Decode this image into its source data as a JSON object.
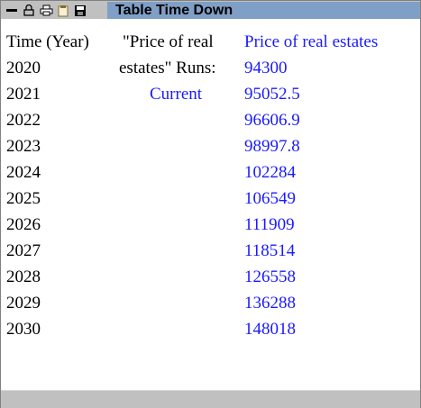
{
  "window": {
    "title": "Table Time Down",
    "toolbar_icons": [
      "minimize-icon",
      "lock-icon",
      "print-icon",
      "copy-icon",
      "save-icon"
    ]
  },
  "table": {
    "time_header": "Time (Year)",
    "runs_label_line1": "\"Price of real",
    "runs_label_line2": "estates\"  Runs:",
    "run_name": "Current",
    "variable_header": "Price of real estates",
    "rows": [
      {
        "time": "2020",
        "value": "94300"
      },
      {
        "time": "2021",
        "value": "95052.5"
      },
      {
        "time": "2022",
        "value": "96606.9"
      },
      {
        "time": "2023",
        "value": "98997.8"
      },
      {
        "time": "2024",
        "value": "102284"
      },
      {
        "time": "2025",
        "value": "106549"
      },
      {
        "time": "2026",
        "value": "111909"
      },
      {
        "time": "2027",
        "value": "118514"
      },
      {
        "time": "2028",
        "value": "126558"
      },
      {
        "time": "2029",
        "value": "136288"
      },
      {
        "time": "2030",
        "value": "148018"
      }
    ]
  },
  "colors": {
    "title_band": "#7f9fc6",
    "value_text": "#1a1aff",
    "chrome": "#c0c0c0"
  }
}
